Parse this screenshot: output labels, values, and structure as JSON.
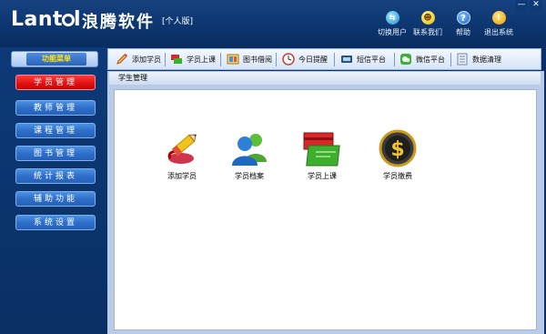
{
  "header": {
    "logo": "Lantel",
    "app_name": "浪腾软件",
    "edition": "[个人版]",
    "buttons": [
      {
        "label": "切换用户",
        "icon": "switch-user-icon"
      },
      {
        "label": "联系我们",
        "icon": "contact-icon"
      },
      {
        "label": "帮助",
        "icon": "help-icon"
      },
      {
        "label": "退出系统",
        "icon": "exit-icon"
      }
    ],
    "window_controls": {
      "minimize": "—",
      "close": "✕"
    }
  },
  "sidebar": {
    "title": "功能菜单",
    "items": [
      {
        "label": "学员管理",
        "active": true
      },
      {
        "label": "教师管理",
        "active": false
      },
      {
        "label": "课程管理",
        "active": false
      },
      {
        "label": "图书管理",
        "active": false
      },
      {
        "label": "统计报表",
        "active": false
      },
      {
        "label": "辅助功能",
        "active": false
      },
      {
        "label": "系统设置",
        "active": false
      }
    ]
  },
  "toolbar": {
    "items": [
      {
        "label": "添加学员",
        "icon": "pencil-icon"
      },
      {
        "label": "学员上课",
        "icon": "cards-icon"
      },
      {
        "label": "图书借阅",
        "icon": "book-icon"
      },
      {
        "label": "今日提醒",
        "icon": "clock-icon"
      },
      {
        "label": "短信平台",
        "icon": "sms-icon"
      },
      {
        "label": "微信平台",
        "icon": "wechat-icon"
      },
      {
        "label": "数据清理",
        "icon": "data-clean-icon"
      }
    ]
  },
  "content": {
    "title": "学生管理",
    "modules": [
      {
        "label": "添加学员",
        "icon": "add-student-icon"
      },
      {
        "label": "学员档案",
        "icon": "student-records-icon"
      },
      {
        "label": "学员上课",
        "icon": "student-class-icon"
      },
      {
        "label": "学员缴费",
        "icon": "payment-icon"
      }
    ]
  },
  "colors": {
    "accent_red": "#e20f0f",
    "nav_blue": "#2e6fc9",
    "background_navy": "#0b2f66"
  }
}
